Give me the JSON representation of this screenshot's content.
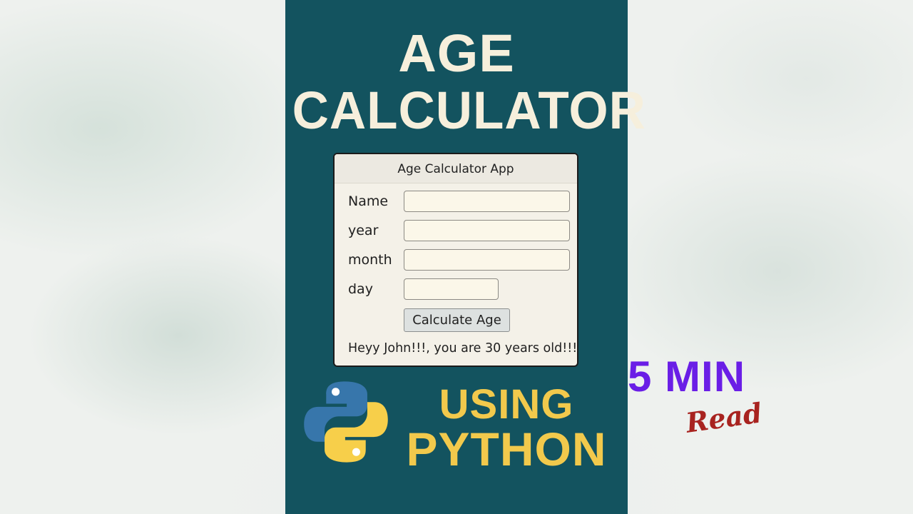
{
  "headline": {
    "line1": "AGE",
    "line2": "CALCULATOR"
  },
  "app": {
    "window_title": "Age Calculator App",
    "fields": {
      "name": {
        "label": "Name",
        "value": ""
      },
      "year": {
        "label": "year",
        "value": ""
      },
      "month": {
        "label": "month",
        "value": ""
      },
      "day": {
        "label": "day",
        "value": ""
      }
    },
    "button_label": "Calculate Age",
    "result": "Heyy John!!!, you are 30 years old!!!"
  },
  "footer": {
    "using": "USING",
    "python": "PYTHON"
  },
  "badge": {
    "minutes": "5 MIN",
    "read": "Read"
  },
  "icons": {
    "logo": "python-logo-icon"
  },
  "colors": {
    "panel": "#13535f",
    "headline": "#f6efdc",
    "python_text": "#f2c94c",
    "badge": "#6a1ee6",
    "read": "#a8231f",
    "python_blue": "#3776ab",
    "python_yellow": "#ffd343"
  }
}
